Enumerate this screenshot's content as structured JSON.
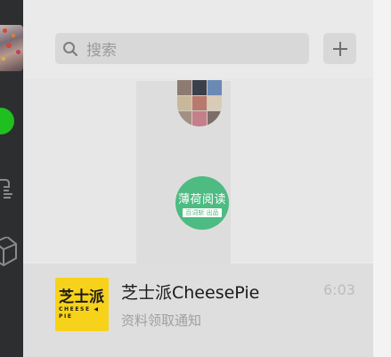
{
  "search": {
    "placeholder": "搜索",
    "icon": "search-icon"
  },
  "toolbar": {
    "add_icon": "plus-icon"
  },
  "nav": {
    "items": [
      {
        "icon": "profile-avatar"
      },
      {
        "icon": "chat-status-dot"
      },
      {
        "icon": "contacts-icon"
      },
      {
        "icon": "cube-icon"
      }
    ]
  },
  "featured": {
    "title": "薄荷阅读",
    "subtitle": "百词斩 出品"
  },
  "chat": {
    "avatar_cn": "芝士派",
    "avatar_en_line1": "CHEESE ◀",
    "avatar_en_line2": "PIE",
    "name": "芝士派CheesePie",
    "preview": "资料领取通知",
    "time": "6:03"
  },
  "colors": {
    "nav_bg": "#2d2e2f",
    "accent_green": "#1fbf1f",
    "mint": "#4dbb82",
    "avatar_yellow": "#f7d21a"
  }
}
